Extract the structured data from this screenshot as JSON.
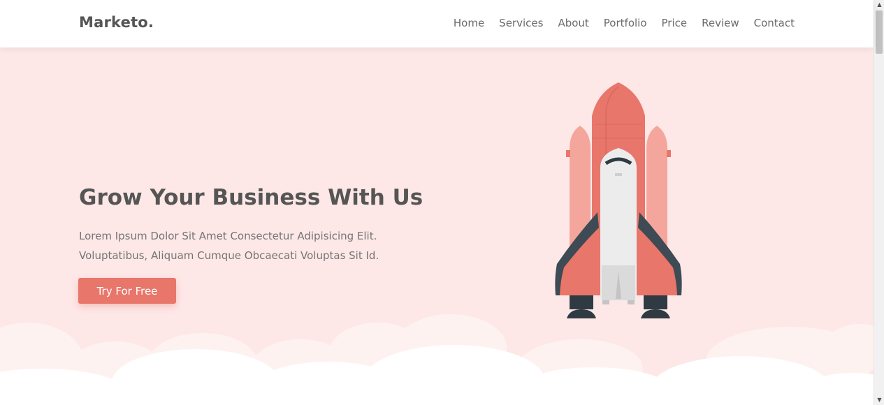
{
  "brand": {
    "logo": "Marketo."
  },
  "nav": {
    "items": [
      {
        "label": "Home"
      },
      {
        "label": "Services"
      },
      {
        "label": "About"
      },
      {
        "label": "Portfolio"
      },
      {
        "label": "Price"
      },
      {
        "label": "Review"
      },
      {
        "label": "Contact"
      }
    ]
  },
  "hero": {
    "title": "Grow Your Business With Us",
    "text": "Lorem Ipsum Dolor Sit Amet Consectetur Adipisicing Elit. Voluptatibus, Aliquam Cumque Obcaecati Voluptas Sit Id.",
    "button_label": "Try For Free",
    "illustration": "rocket-illustration"
  },
  "scrollbar": {
    "up_icon": "arrow-up-icon",
    "down_icon": "arrow-down-icon"
  },
  "colors": {
    "accent": "#e8766b",
    "hero_background": "#fde8e7",
    "navbar_background": "#ffffff",
    "heading_text": "#555555",
    "body_text": "#747474"
  }
}
